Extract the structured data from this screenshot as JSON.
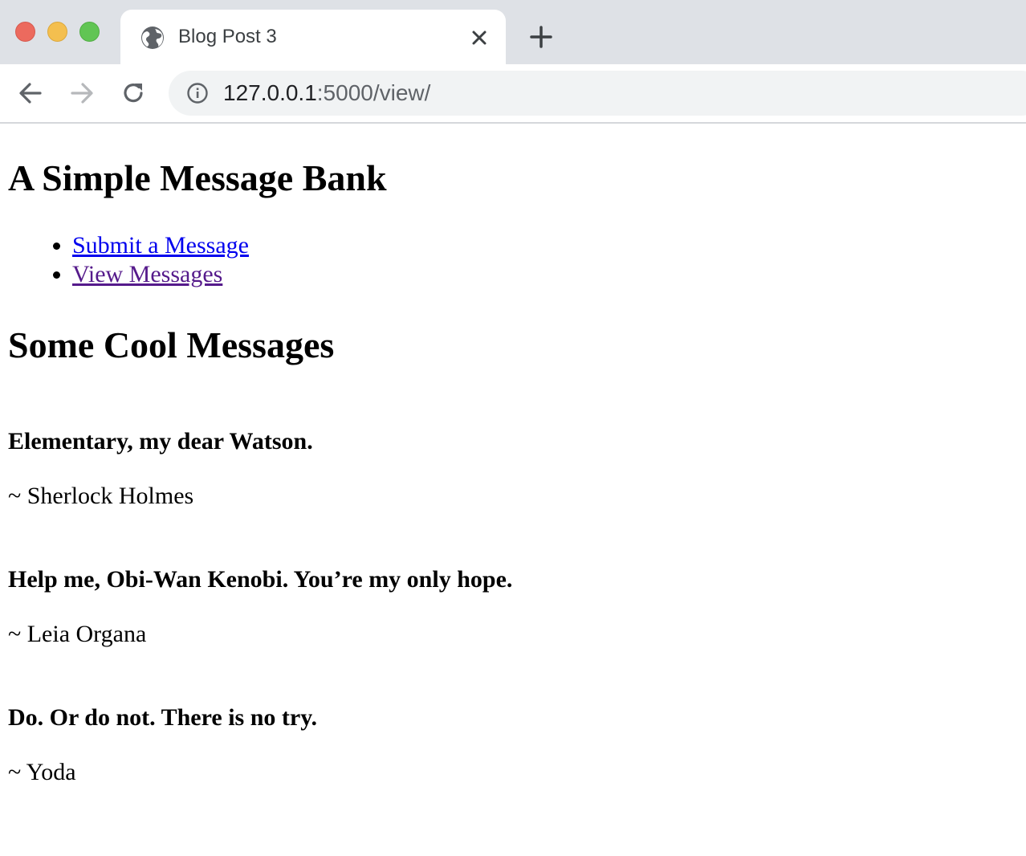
{
  "browser": {
    "tab": {
      "title": "Blog Post 3",
      "favicon_icon": "globe-icon",
      "close_icon": "close-icon"
    },
    "new_tab_icon": "plus-icon",
    "nav": {
      "back_icon": "arrow-left-icon",
      "forward_icon": "arrow-right-icon",
      "reload_icon": "reload-icon"
    },
    "address": {
      "info_icon": "info-icon",
      "host": "127.0.0.1",
      "path": ":5000/view/"
    },
    "colors": {
      "chrome_bg": "#dee1e6",
      "omnibox_bg": "#f1f3f4",
      "close_red": "#ec6a5e",
      "minimize_yellow": "#f4bf4f",
      "maximize_green": "#61c554"
    }
  },
  "page": {
    "title": "A Simple Message Bank",
    "nav_links": [
      {
        "label": "Submit a Message",
        "state": "unvisited"
      },
      {
        "label": "View Messages",
        "state": "visited"
      }
    ],
    "messages_heading": "Some Cool Messages",
    "messages": [
      {
        "text": "Elementary, my dear Watson.",
        "author": "~ Sherlock Holmes"
      },
      {
        "text": "Help me, Obi-Wan Kenobi. You’re my only hope.",
        "author": "~ Leia Organa"
      },
      {
        "text": "Do. Or do not. There is no try.",
        "author": "~ Yoda"
      }
    ],
    "colors": {
      "link_unvisited": "#0000ee",
      "link_visited": "#551a8b"
    }
  }
}
